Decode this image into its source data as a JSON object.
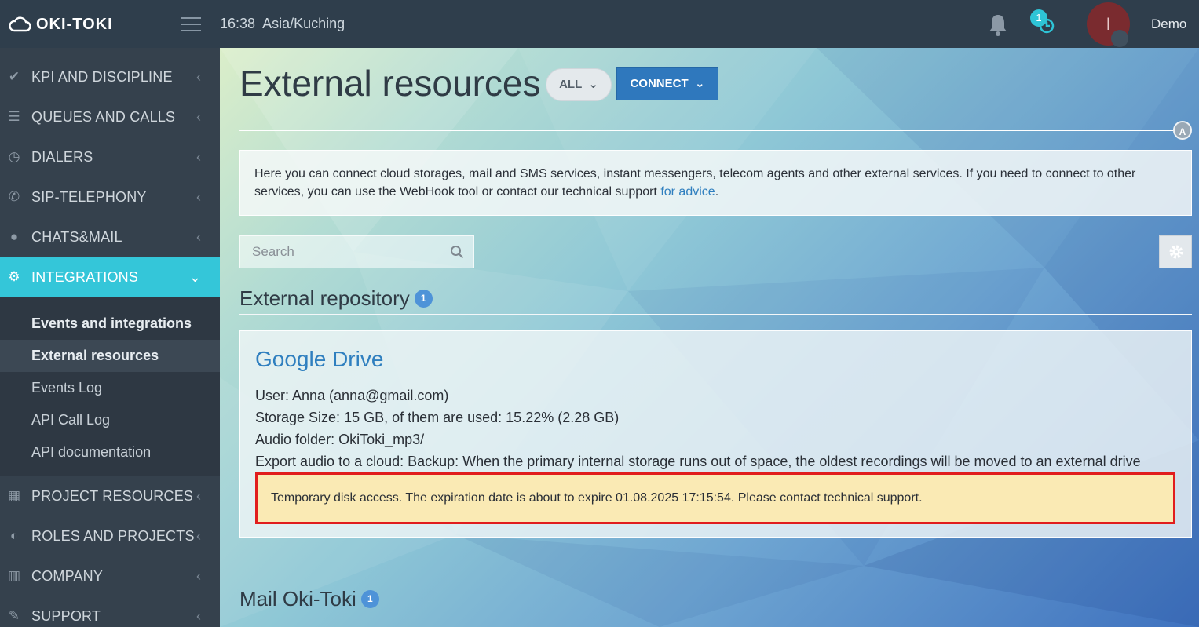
{
  "header": {
    "logo_text": "OKI-TOKI",
    "time": "16:38",
    "timezone": "Asia/Kuching",
    "history_count": "1",
    "avatar_initial": "I",
    "username": "Demo"
  },
  "sidebar": {
    "items_top": [
      {
        "label": "KPI AND DISCIPLINE",
        "icon": "check-icon"
      },
      {
        "label": "QUEUES AND CALLS",
        "icon": "list-icon"
      },
      {
        "label": "DIALERS",
        "icon": "clock-icon"
      },
      {
        "label": "SIP-TELEPHONY",
        "icon": "phone-icon"
      },
      {
        "label": "CHATS&MAIL",
        "icon": "chat-icon"
      },
      {
        "label": "INTEGRATIONS",
        "icon": "gears-icon"
      }
    ],
    "sub_items": [
      {
        "label": "Events and integrations"
      },
      {
        "label": "External resources"
      },
      {
        "label": "Events Log"
      },
      {
        "label": "API Call Log"
      },
      {
        "label": "API documentation"
      }
    ],
    "items_bottom": [
      {
        "label": "PROJECT RESOURCES",
        "icon": "grid-icon"
      },
      {
        "label": "ROLES AND PROJECTS",
        "icon": "toggle-icon"
      },
      {
        "label": "COMPANY",
        "icon": "bar-chart-icon"
      },
      {
        "label": "SUPPORT",
        "icon": "wrench-icon"
      }
    ]
  },
  "main": {
    "title": "External resources",
    "filter_label": "ALL",
    "connect_label": "CONNECT",
    "divider_badge": "A",
    "info_text": "Here you can connect cloud storages, mail and SMS services, instant messengers, telecom agents and other external services. If you need to connect to other services, you can use the WebHook tool or contact our technical support ",
    "info_link": "for advice",
    "info_tail": ".",
    "search_placeholder": "Search",
    "section_repository": {
      "title": "External repository",
      "count": "1"
    },
    "card": {
      "title": "Google Drive",
      "user_line": "User: Anna (anna@gmail.com)",
      "storage_line": "Storage Size: 15 GB, of them are used: 15.22% (2.28 GB)",
      "audio_line": "Audio folder: OkiToki_mp3/",
      "export_line": "Export audio to a cloud: Backup: When the primary internal storage runs out of space, the oldest recordings will be moved to an external drive",
      "warning": "Temporary disk access. The expiration date is about to expire 01.08.2025 17:15:54. Please contact technical support."
    },
    "section_mail": {
      "title": "Mail Oki-Toki",
      "count": "1"
    }
  },
  "colors": {
    "topbar": "#2f3e4c",
    "sidebar": "#35414d",
    "active": "#34c6d9",
    "connect": "#2f78bd",
    "link": "#2f7fbf",
    "warning_bg": "#faeab4",
    "warning_border": "#e11d1d"
  }
}
